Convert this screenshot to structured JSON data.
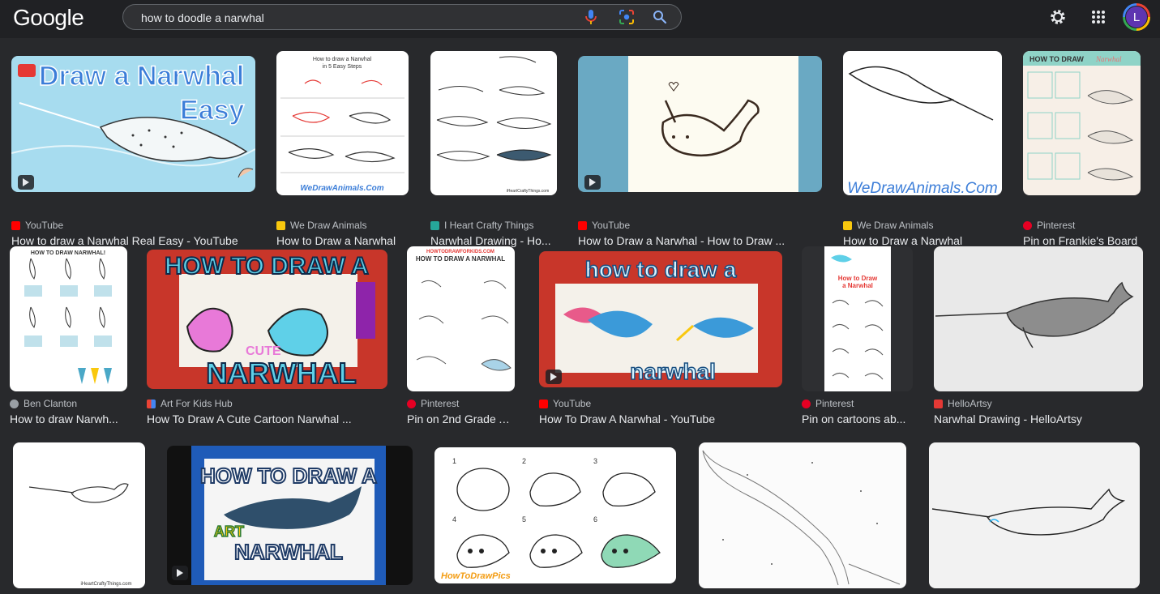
{
  "header": {
    "logo": "Google",
    "search_value": "how to doodle a narwhal",
    "avatar_letter": "L"
  },
  "results": [
    {
      "source": "YouTube",
      "title": "How to draw a Narwhal Real Easy - YouTube",
      "thumb_text": [
        "Draw a Narwhal",
        "Easy"
      ],
      "fav": "#ff0000",
      "video": true
    },
    {
      "source": "We Draw Animals",
      "title": "How to Draw a Narwhal",
      "thumb_text": [
        "How to draw a Narwhal",
        "in 5 Easy Steps",
        "WeDrawAnimals.Com"
      ],
      "fav": "#f9c80e",
      "video": false
    },
    {
      "source": "I Heart Crafty Things",
      "title": "Narwhal Drawing - Ho...",
      "thumb_text": [
        "iHeartCraftyThings.com"
      ],
      "fav": "#26a69a",
      "video": false
    },
    {
      "source": "YouTube",
      "title": "How to Draw a Narwhal - How to Draw ...",
      "thumb_text": [],
      "fav": "#ff0000",
      "video": true
    },
    {
      "source": "We Draw Animals",
      "title": "How to Draw a Narwhal",
      "thumb_text": [
        "WeDrawAnimals.Com"
      ],
      "fav": "#f9c80e",
      "video": false
    },
    {
      "source": "Pinterest",
      "title": "Pin on Frankie's Board",
      "thumb_text": [
        "HOW TO DRAW",
        "Narwhal"
      ],
      "fav": "#e60023",
      "video": false
    },
    {
      "source": "Ben Clanton",
      "title": "How to draw Narwh...",
      "thumb_text": [
        "HOW TO DRAW NARWHAL!"
      ],
      "fav": "#9aa0a6",
      "video": false
    },
    {
      "source": "Art For Kids Hub",
      "title": "How To Draw A Cute Cartoon Narwhal ...",
      "thumb_text": [
        "HOW TO DRAW A",
        "CUTE",
        "NARWHAL"
      ],
      "fav": "#fbbc04",
      "video": false
    },
    {
      "source": "Pinterest",
      "title": "Pin on 2nd Grade A...",
      "thumb_text": [
        "HOWTODRAWFORKIDS.COM",
        "HOW TO DRAW A NARWHAL"
      ],
      "fav": "#e60023",
      "video": false
    },
    {
      "source": "YouTube",
      "title": "How To Draw A Narwhal - YouTube",
      "thumb_text": [
        "how to draw a",
        "narwhal"
      ],
      "fav": "#ff0000",
      "video": true
    },
    {
      "source": "Pinterest",
      "title": "Pin on cartoons ab...",
      "thumb_text": [
        "How to Draw",
        "a Narwhal"
      ],
      "fav": "#e60023",
      "video": false
    },
    {
      "source": "HelloArtsy",
      "title": "Narwhal Drawing - HelloArtsy",
      "thumb_text": [],
      "fav": "#e53935",
      "video": false
    },
    {
      "source": "",
      "title": "",
      "thumb_text": [
        "iHeartCraftyThings.com"
      ],
      "fav": "",
      "video": false
    },
    {
      "source": "",
      "title": "",
      "thumb_text": [
        "HOW TO DRAW A",
        "NARWHAL",
        "ART"
      ],
      "fav": "",
      "video": true
    },
    {
      "source": "",
      "title": "",
      "thumb_text": [
        "1",
        "2",
        "3",
        "4",
        "5",
        "6",
        "HowToDrawPics"
      ],
      "fav": "",
      "video": false
    },
    {
      "source": "",
      "title": "",
      "thumb_text": [],
      "fav": "",
      "video": false
    },
    {
      "source": "",
      "title": "",
      "thumb_text": [],
      "fav": "",
      "video": false
    }
  ]
}
